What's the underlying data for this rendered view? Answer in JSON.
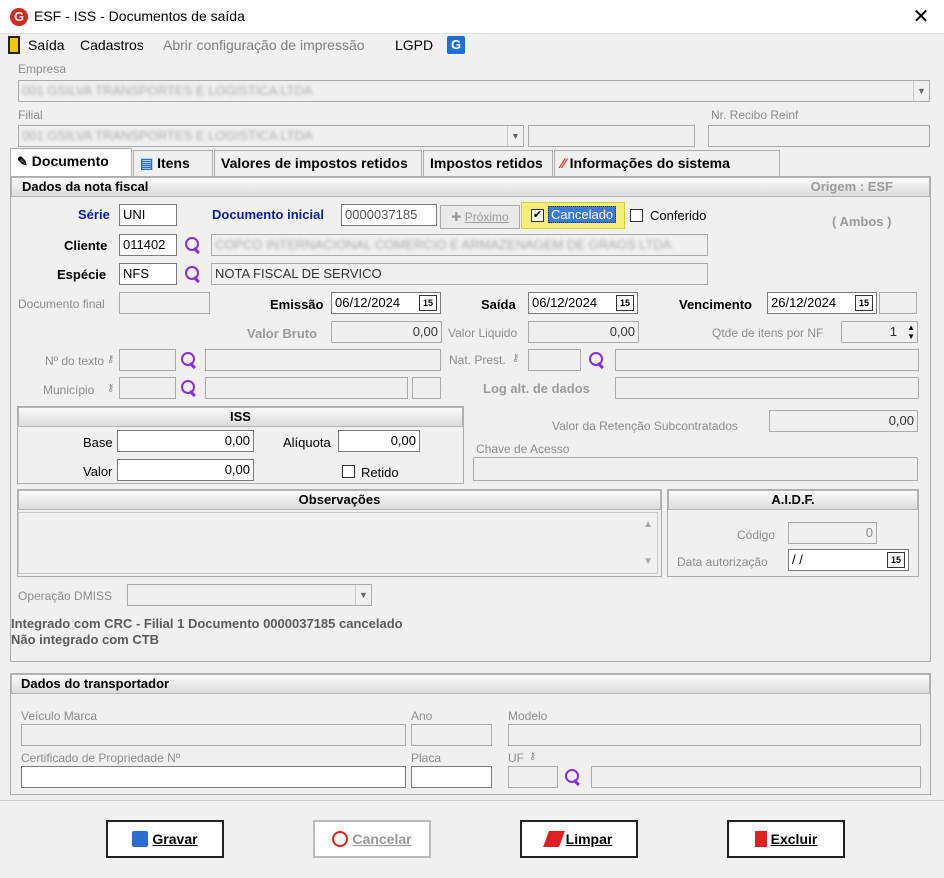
{
  "window": {
    "title": "ESF - ISS - Documentos de saída"
  },
  "menu": {
    "saida": "Saída",
    "cadastros": "Cadastros",
    "abrir_config": "Abrir configuração de impressão",
    "lgpd": "LGPD"
  },
  "header": {
    "empresa_label": "Empresa",
    "empresa_value": "001 GSILVA TRANSPORTES E LOGISTICA LTDA",
    "filial_label": "Filial",
    "filial_value": "001 GSILVA TRANSPORTES E LOGISTICA LTDA",
    "recibo_label": "Nr. Recibo Reinf"
  },
  "tabs": [
    "Documento",
    "Itens",
    "Valores de impostos retidos",
    "Impostos retidos",
    "Informações do sistema"
  ],
  "nota": {
    "section_title": "Dados da nota fiscal",
    "origem": "Origem : ESF",
    "ambos": "( Ambos )",
    "serie_label": "Série",
    "serie": "UNI",
    "doc_inicial_label": "Documento inicial",
    "doc_inicial": "0000037185",
    "proximo": "Próximo",
    "cancelado": "Cancelado",
    "conferido": "Conferido",
    "cliente_label": "Cliente",
    "cliente": "011402",
    "cliente_nome": "COPCO INTERNACIONAL COMERCIO E ARMAZENAGEM DE GRAOS LTDA",
    "especie_label": "Espécie",
    "especie": "NFS",
    "especie_desc": "NOTA FISCAL DE SERVICO",
    "doc_final_label": "Documento final",
    "emissao_label": "Emissão",
    "emissao": "06/12/2024",
    "saida_label": "Saída",
    "saida": "06/12/2024",
    "vencimento_label": "Vencimento",
    "vencimento": "26/12/2024",
    "valor_bruto_label": "Valor Bruto",
    "valor_bruto": "0,00",
    "valor_liquido_label": "Valor Liquido",
    "valor_liquido": "0,00",
    "qtde_label": "Qtde de itens por NF",
    "qtde": "1",
    "nr_texto_label": "Nº do texto",
    "nat_prest_label": "Nat. Prest.",
    "municipio_label": "Município",
    "log_alt_label": "Log alt. de dados"
  },
  "iss": {
    "title": "ISS",
    "base_label": "Base",
    "base": "0,00",
    "aliquota_label": "Alíquota",
    "aliquota": "0,00",
    "valor_label": "Valor",
    "valor": "0,00",
    "retido_label": "Retido"
  },
  "retencao": {
    "label": "Valor da Retenção Subcontratados",
    "value": "0,00",
    "chave_label": "Chave de Acesso"
  },
  "obs": {
    "title": "Observações"
  },
  "aidf": {
    "title": "A.I.D.F.",
    "codigo_label": "Código",
    "codigo": "0",
    "data_label": "Data autorização",
    "data": " / /"
  },
  "dmiss": {
    "label": "Operação DMISS"
  },
  "status": {
    "line1": "Integrado com CRC - Filial 1 Documento 0000037185 cancelado",
    "line2": "Não integrado com CTB"
  },
  "transp": {
    "title": "Dados do transportador",
    "veiculo_label": "Veículo Marca",
    "ano_label": "Ano",
    "modelo_label": "Modelo",
    "certificado_label": "Certificado de Propriedade Nº",
    "placa_label": "Placa",
    "uf_label": "UF"
  },
  "buttons": {
    "gravar": "Gravar",
    "cancelar": "Cancelar",
    "limpar": "Limpar",
    "excluir": "Excluir"
  },
  "calendar_glyph": "15"
}
